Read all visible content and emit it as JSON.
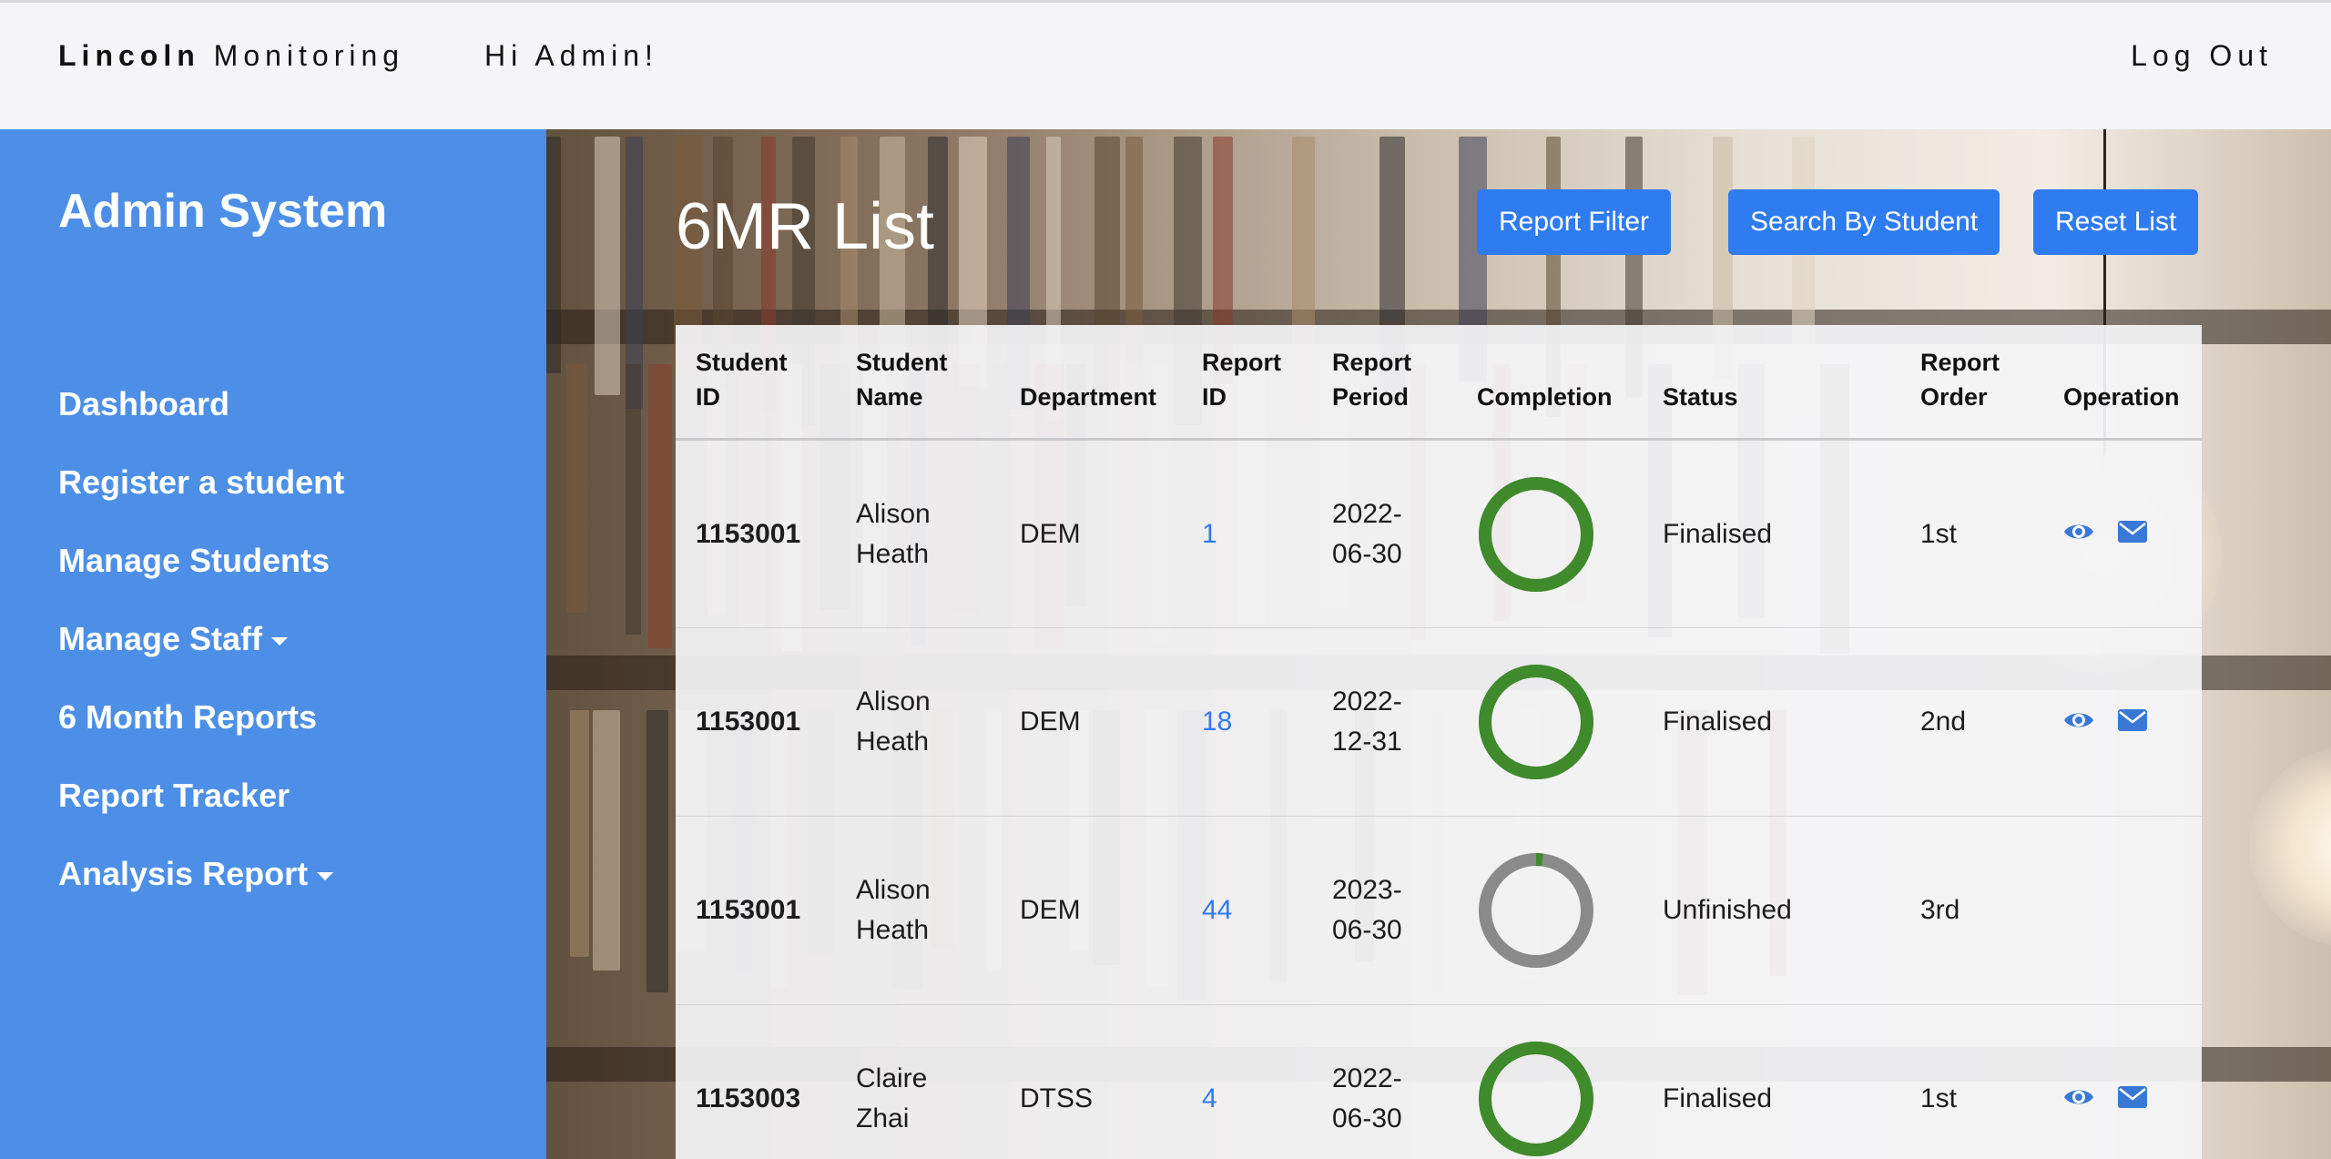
{
  "navbar": {
    "brand_bold": "Lincoln",
    "brand_rest": "Monitoring",
    "greeting": "Hi Admin!",
    "logout": "Log Out"
  },
  "sidebar": {
    "title": "Admin System",
    "items": [
      {
        "label": "Dashboard",
        "dropdown": false
      },
      {
        "label": "Register a student",
        "dropdown": false
      },
      {
        "label": "Manage Students",
        "dropdown": false
      },
      {
        "label": "Manage Staff",
        "dropdown": true
      },
      {
        "label": "6 Month Reports",
        "dropdown": false
      },
      {
        "label": "Report Tracker",
        "dropdown": false
      },
      {
        "label": "Analysis Report",
        "dropdown": true
      }
    ]
  },
  "main": {
    "title": "6MR List",
    "buttons": {
      "report_filter": "Report Filter",
      "search_by_student": "Search By Student",
      "reset_list": "Reset List"
    },
    "table": {
      "headers": {
        "student_id": [
          "Student",
          "ID"
        ],
        "student_name": [
          "Student",
          "Name"
        ],
        "department": [
          "Department"
        ],
        "report_id": [
          "Report",
          "ID"
        ],
        "report_period": [
          "Report",
          "Period"
        ],
        "completion": [
          "Completion"
        ],
        "status": [
          "Status"
        ],
        "report_order": [
          "Report",
          "Order"
        ],
        "operation": [
          "Operation"
        ]
      },
      "rows": [
        {
          "student_id": "1153001",
          "name_first": "Alison",
          "name_last": "Heath",
          "department": "DEM",
          "report_id": "1",
          "period_a": "2022-",
          "period_b": "06-30",
          "completion": 1.0,
          "status": "Finalised",
          "order": "1st",
          "ops": true
        },
        {
          "student_id": "1153001",
          "name_first": "Alison",
          "name_last": "Heath",
          "department": "DEM",
          "report_id": "18",
          "period_a": "2022-",
          "period_b": "12-31",
          "completion": 1.0,
          "status": "Finalised",
          "order": "2nd",
          "ops": true
        },
        {
          "student_id": "1153001",
          "name_first": "Alison",
          "name_last": "Heath",
          "department": "DEM",
          "report_id": "44",
          "period_a": "2023-",
          "period_b": "06-30",
          "completion": 0.02,
          "status": "Unfinished",
          "order": "3rd",
          "ops": false
        },
        {
          "student_id": "1153003",
          "name_first": "Claire",
          "name_last": "Zhai",
          "department": "DTSS",
          "report_id": "4",
          "period_a": "2022-",
          "period_b": "06-30",
          "completion": 1.0,
          "status": "Finalised",
          "order": "1st",
          "ops": true
        }
      ]
    }
  },
  "colors": {
    "sidebar": "#4d8fe6",
    "button": "#2f7bf0",
    "link": "#2f7bf0",
    "ring_done": "#3f8a2a",
    "ring_todo": "#8a8a8a",
    "icon": "#3a78d6"
  },
  "icons": {
    "view": "eye-icon",
    "email": "envelope-icon"
  }
}
